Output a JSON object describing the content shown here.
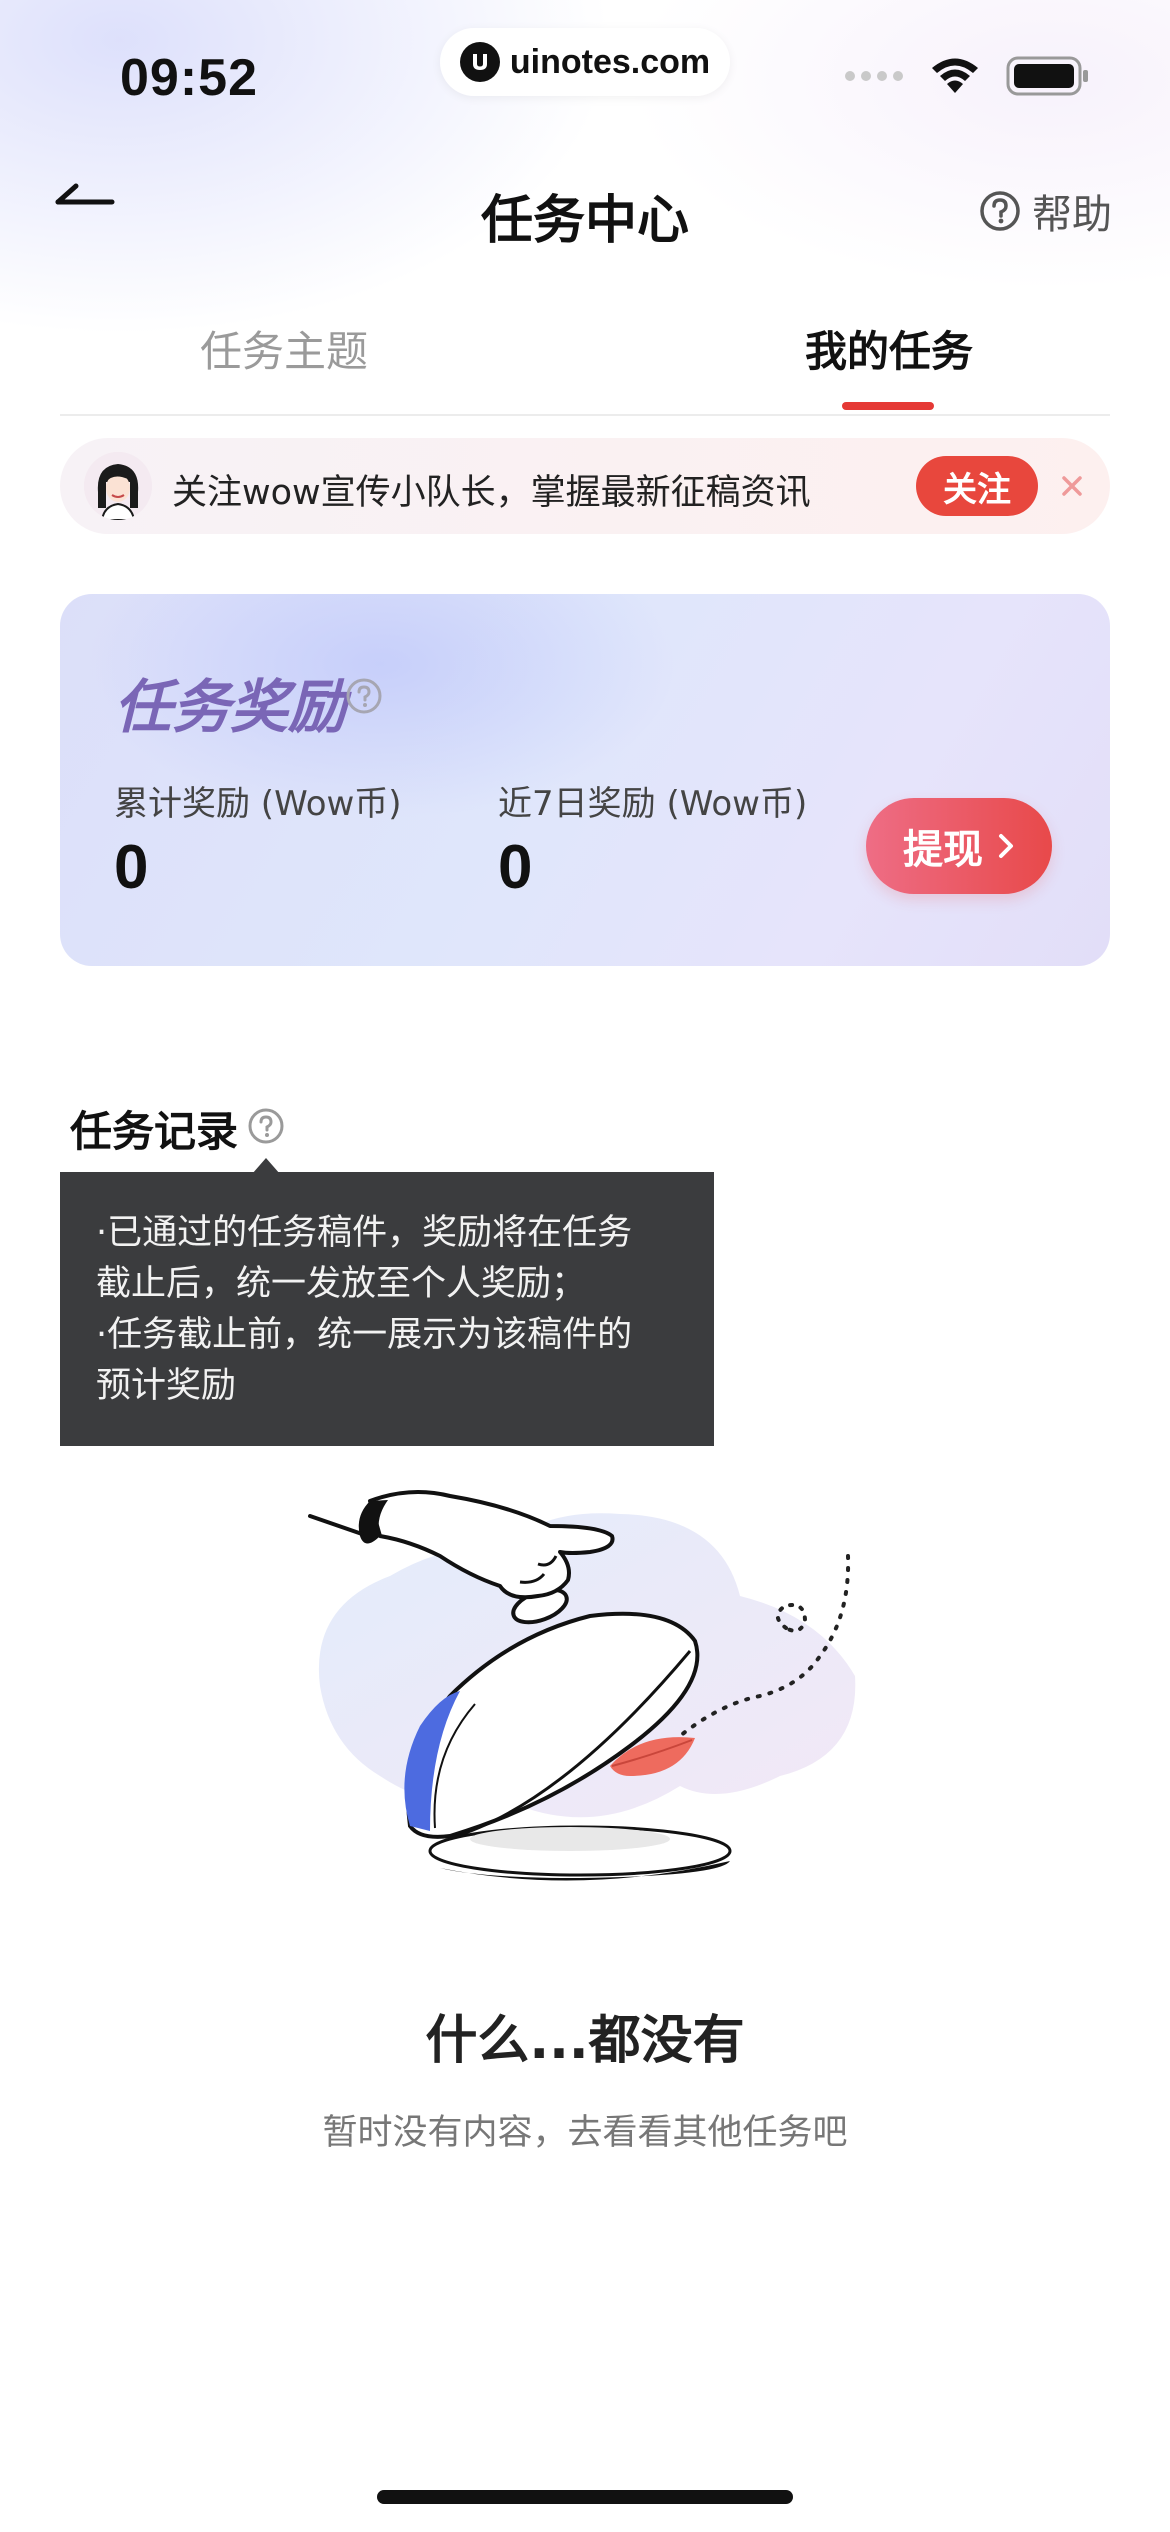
{
  "status_bar": {
    "time": "09:52",
    "watermark": "uinotes.com"
  },
  "header": {
    "title": "任务中心",
    "help_label": "帮助"
  },
  "tabs": [
    {
      "label": "任务主题",
      "active": false
    },
    {
      "label": "我的任务",
      "active": true
    }
  ],
  "banner": {
    "text": "关注wow宣传小队长，掌握最新征稿资讯",
    "follow_label": "关注"
  },
  "reward_card": {
    "title": "任务奖励",
    "total_label": "累计奖励 (Wow币)",
    "total_value": "0",
    "recent_label": "近7日奖励 (Wow币)",
    "recent_value": "0",
    "withdraw_label": "提现"
  },
  "records": {
    "title": "任务记录",
    "tooltip_lines": [
      "·已通过的任务稿件，奖励将在任务",
      "截止后，统一发放至个人奖励；",
      "·任务截止前，统一展示为该稿件的",
      "预计奖励"
    ]
  },
  "empty_state": {
    "title": "什么...都没有",
    "subtitle": "暂时没有内容，去看看其他任务吧"
  },
  "colors": {
    "accent": "#e53935",
    "follow_button": "#e8473d",
    "reward_title": "#7a66b6",
    "tooltip_bg": "#3b3c3e"
  },
  "icons": [
    "back-arrow-icon",
    "help-circle-icon",
    "close-icon",
    "chevron-right-icon",
    "question-icon",
    "wifi-icon",
    "battery-icon",
    "signal-icon"
  ]
}
